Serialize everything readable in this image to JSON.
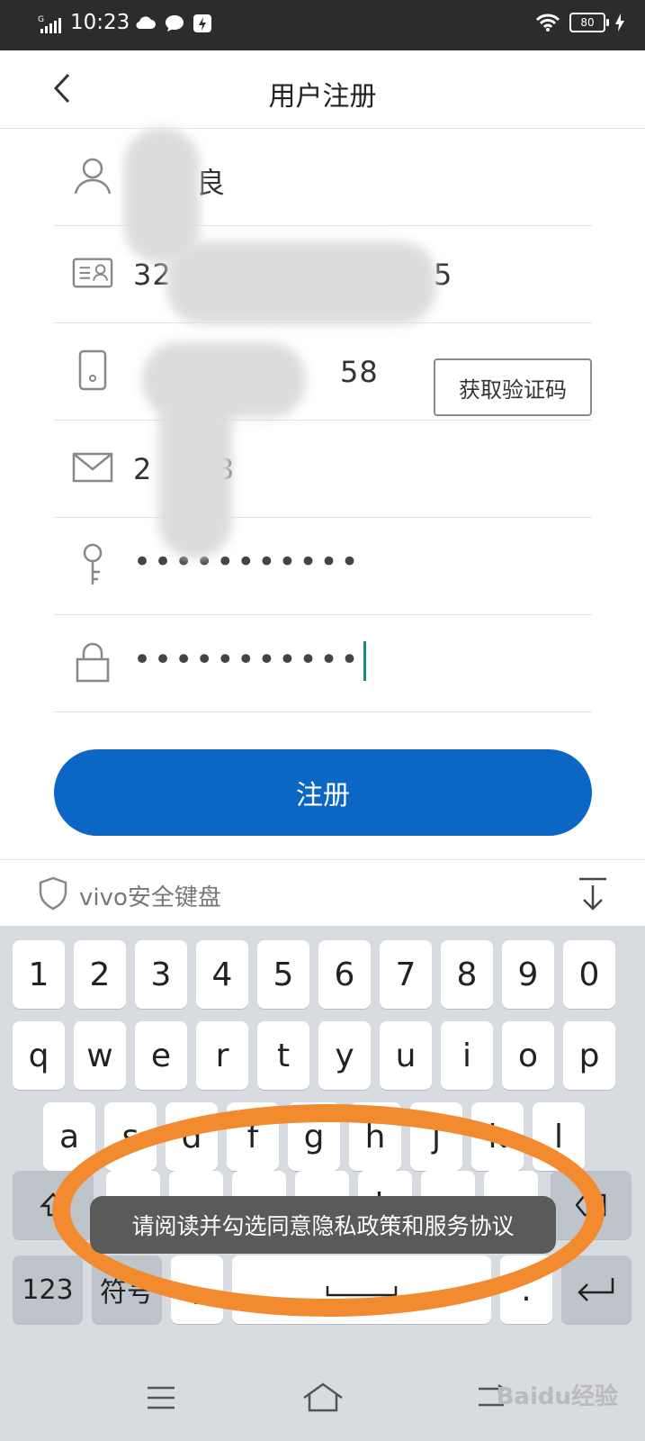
{
  "status_bar": {
    "time": "10:23",
    "battery": "80",
    "signal_label": "G"
  },
  "title_bar": {
    "title": "用户注册"
  },
  "form": {
    "name": {
      "value": "良"
    },
    "id_number": {
      "value_start": "32",
      "value_end": "5"
    },
    "phone": {
      "value_end": "58",
      "get_code_label": "获取验证码"
    },
    "email": {
      "value_start": "2",
      "value_end": "3"
    },
    "password": {
      "dots": "•••••••••••"
    },
    "confirm_password": {
      "dots": "•••••••••••"
    },
    "register_label": "注册"
  },
  "keyboard": {
    "header_label": "vivo安全键盘",
    "row1": [
      "1",
      "2",
      "3",
      "4",
      "5",
      "6",
      "7",
      "8",
      "9",
      "0"
    ],
    "row2": [
      "q",
      "w",
      "e",
      "r",
      "t",
      "y",
      "u",
      "i",
      "o",
      "p"
    ],
    "row3": [
      "a",
      "s",
      "d",
      "f",
      "g",
      "h",
      "j",
      "k",
      "l"
    ],
    "key_123": "123",
    "key_symbol": "符号",
    "key_comma": ",",
    "key_period": "."
  },
  "toast": {
    "message": "请阅读并勾选同意隐私政策和服务协议"
  },
  "watermark": "Baidu经验",
  "colors": {
    "primary": "#0b66c4",
    "highlight": "#f28a30",
    "cursor": "#1a8a7a"
  }
}
